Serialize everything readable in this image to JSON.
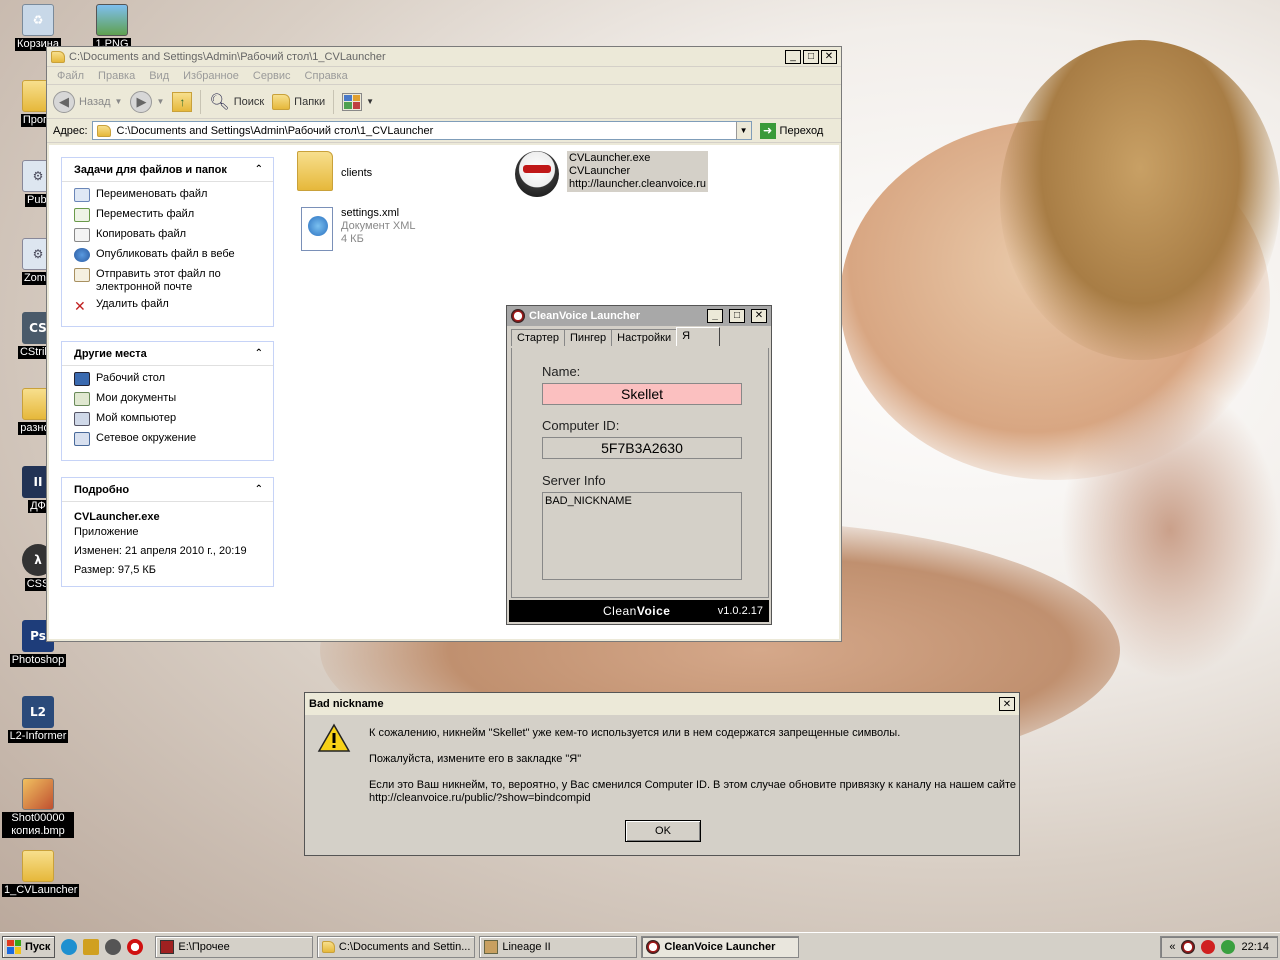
{
  "desktop": {
    "icons": [
      {
        "label": "Корзина"
      },
      {
        "label": "1.PNG"
      },
      {
        "label": "Прогр"
      },
      {
        "label": "Publ"
      },
      {
        "label": "Zomb"
      },
      {
        "label": "CStrike"
      },
      {
        "label": "разное"
      },
      {
        "label": "ДФ"
      },
      {
        "label": "CSS"
      },
      {
        "label": "Photoshop"
      },
      {
        "label": "L2-Informer"
      },
      {
        "label": "Shot00000 копия.bmp"
      },
      {
        "label": "1_CVLauncher"
      }
    ]
  },
  "explorer": {
    "title": "C:\\Documents and Settings\\Admin\\Рабочий стол\\1_CVLauncher",
    "menu": [
      "Файл",
      "Правка",
      "Вид",
      "Избранное",
      "Сервис",
      "Справка"
    ],
    "toolbar": {
      "back": "Назад",
      "search": "Поиск",
      "folders": "Папки"
    },
    "address_label": "Адрес:",
    "address_value": "C:\\Documents and Settings\\Admin\\Рабочий стол\\1_CVLauncher",
    "go_label": "Переход",
    "tasks_panel": {
      "title": "Задачи для файлов и папок",
      "items": [
        "Переименовать файл",
        "Переместить файл",
        "Копировать файл",
        "Опубликовать файл в вебе",
        "Отправить этот файл по электронной почте",
        "Удалить файл"
      ]
    },
    "places_panel": {
      "title": "Другие места",
      "items": [
        "Рабочий стол",
        "Мои документы",
        "Мой компьютер",
        "Сетевое окружение"
      ]
    },
    "details_panel": {
      "title": "Подробно",
      "name": "CVLauncher.exe",
      "type": "Приложение",
      "modified": "Изменен: 21 апреля 2010 г., 20:19",
      "size": "Размер: 97,5 КБ"
    },
    "files": [
      {
        "name": "clients"
      },
      {
        "name": "settings.xml",
        "type": "Документ XML",
        "size": "4 КБ"
      },
      {
        "name": "CVLauncher.exe",
        "desc": "CVLauncher",
        "url": "http://launcher.cleanvoice.ru"
      }
    ]
  },
  "cv": {
    "title": "CleanVoice Launcher",
    "tabs": [
      "Стартер",
      "Пингер",
      "Настройки",
      "Я"
    ],
    "name_label": "Name:",
    "name_value": "Skellet",
    "cid_label": "Computer ID:",
    "cid_value": "5F7B3A2630",
    "server_label": "Server Info",
    "server_value": "BAD_NICKNAME",
    "footer_brand_a": "Clean",
    "footer_brand_b": "Voice",
    "version": "v1.0.2.17"
  },
  "dialog": {
    "title": "Bad nickname",
    "line1": "К сожалению, никнейм \"Skellet\"  уже кем-то используется или в нем содержатся запрещенные символы.",
    "line2": "Пожалуйста, измените его в закладке \"Я\"",
    "line3": "Если это Ваш никнейм, то, вероятно, у Вас сменился Computer ID. В этом случае обновите привязку к каналу на нашем сайте",
    "line4": "http://cleanvoice.ru/public/?show=bindcompid",
    "ok": "OK"
  },
  "taskbar": {
    "start": "Пуск",
    "tasks": [
      "E:\\Прочее",
      "C:\\Documents and Settin...",
      "Lineage II",
      "CleanVoice Launcher"
    ],
    "clock": "22:14"
  }
}
